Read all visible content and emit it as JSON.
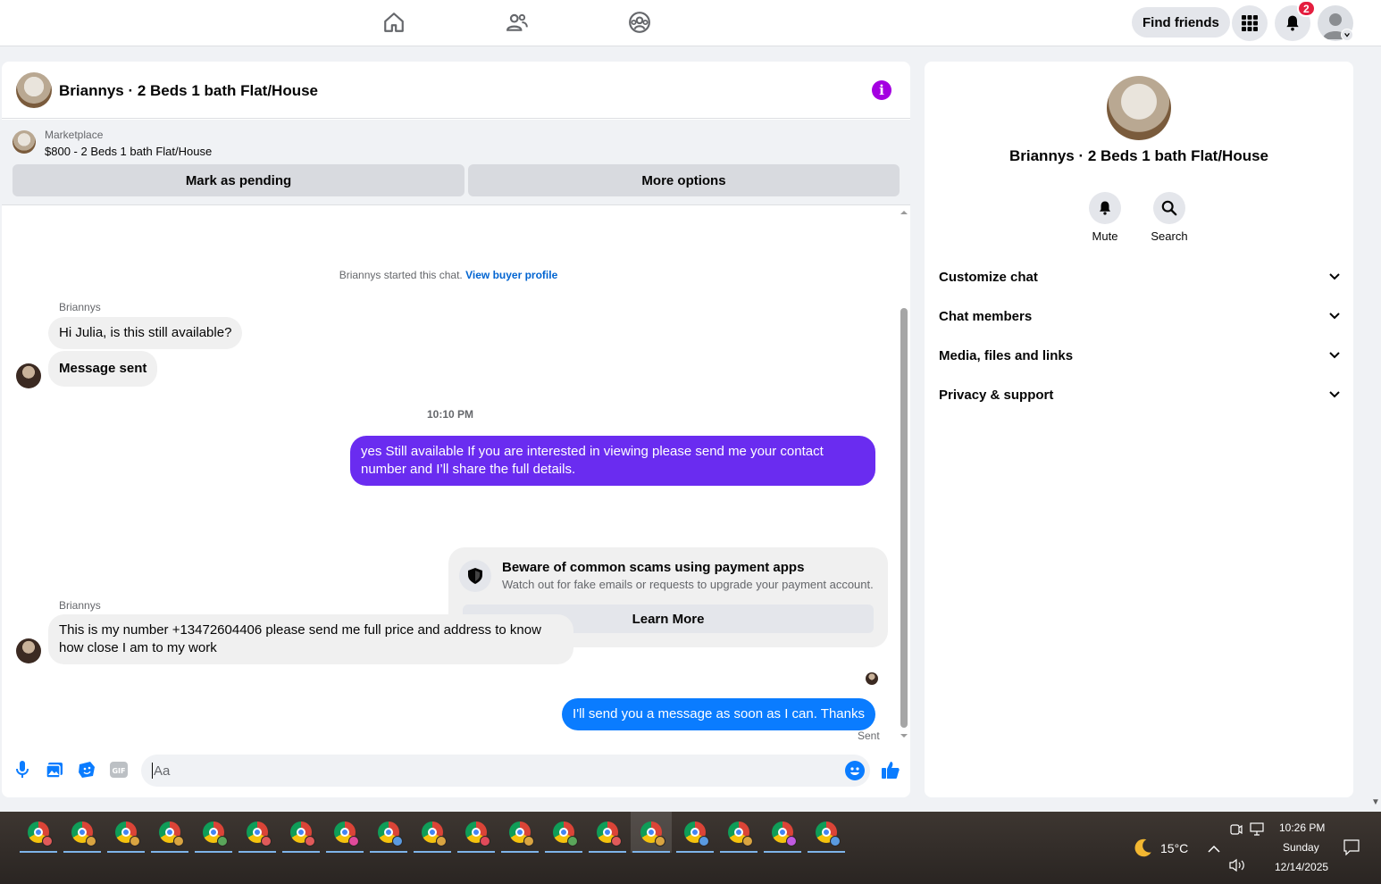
{
  "topbar": {
    "find_friends_label": "Find friends",
    "notification_count": "2"
  },
  "chat": {
    "title": "Briannys · 2 Beds 1 bath Flat/House",
    "marketplace": {
      "label": "Marketplace",
      "item": "$800 - 2 Beds 1 bath Flat/House",
      "mark_pending_label": "Mark as pending",
      "more_options_label": "More options"
    },
    "system_text": "Briannys started this chat.",
    "view_buyer_profile": "View buyer profile",
    "messages": [
      {
        "sender": "Briannys",
        "text": "Hi Julia, is this still available?"
      },
      {
        "text": "Message sent"
      },
      {
        "timestamp": "10:10 PM"
      },
      {
        "text": "yes Still available If you are interested in viewing please send me your contact number and I’ll share the full details."
      },
      {
        "sender": "Briannys",
        "text": "This is my number +13472604406 please send me full price and address to know how close I am to my work"
      },
      {
        "text": "I'll send you a message as soon as I can. Thanks"
      }
    ],
    "warning": {
      "title": "Beware of common scams using payment apps",
      "subtitle": "Watch out for fake emails or requests to upgrade your payment account.",
      "button_label": "Learn More"
    },
    "sent_status": "Sent",
    "composer_placeholder": "Aa"
  },
  "info_panel": {
    "title": "Briannys · 2 Beds 1 bath Flat/House",
    "mute_label": "Mute",
    "search_label": "Search",
    "rows": [
      "Customize chat",
      "Chat members",
      "Media, files and links",
      "Privacy & support"
    ]
  },
  "taskbar": {
    "temperature": "15°C",
    "time": "10:26 PM",
    "day": "Sunday",
    "date": "12/14/2025",
    "profile_colors": [
      "#e05a5a",
      "#d9a441",
      "#d9a441",
      "#d9a441",
      "#5aa55a",
      "#e05a5a",
      "#e05a5a",
      "#e04a9a",
      "#5a9ae0",
      "#d9a441",
      "#e04a5a",
      "#d9a441",
      "#5aa55a",
      "#e05a5a",
      "#d9a441",
      "#5a9ae0",
      "#d9a441",
      "#c05ae0",
      "#5a9ae0"
    ]
  },
  "colors": {
    "accent_purple": "#a400e1",
    "outgoing_purple": "#6a2cf0",
    "outgoing_blue": "#0a7cff",
    "messenger_blue": "#0a7cff"
  }
}
